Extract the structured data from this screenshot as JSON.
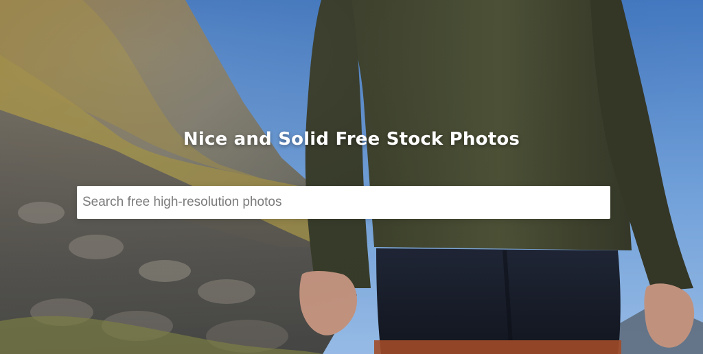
{
  "hero": {
    "title": "Nice and Solid Free Stock Photos",
    "search": {
      "value": "",
      "placeholder": "Search free high-resolution photos"
    }
  },
  "colors": {
    "title_text": "#ffffff",
    "search_bg": "#ffffff",
    "placeholder": "#7b7b7b",
    "sky": "#79aef0",
    "sweater": "#4c5136",
    "shorts": "#1f2431",
    "rocks": "#7f7b74",
    "grass": "#b7a34a"
  }
}
